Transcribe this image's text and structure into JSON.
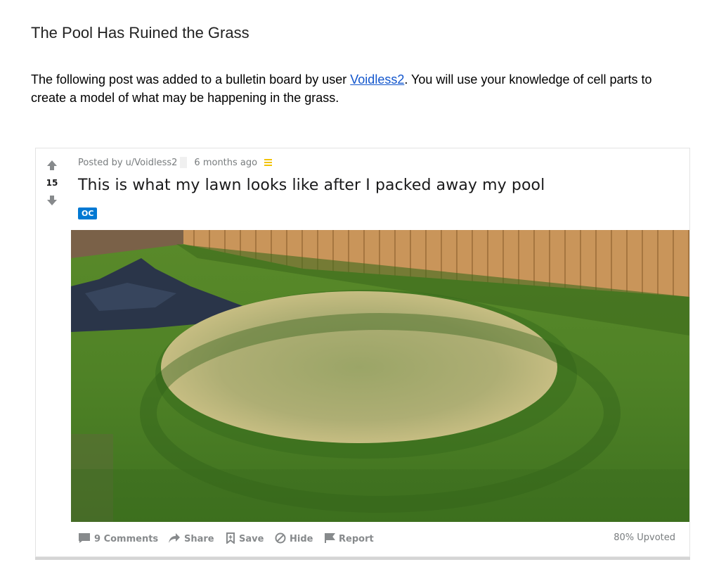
{
  "document": {
    "title": "The Pool Has Ruined the Grass",
    "intro_before_link": "The following post was added to a bulletin board by user ",
    "intro_link": "Voidless2",
    "intro_after_link": ".  You will use your knowledge of cell parts to create a model of what may be happening in the grass."
  },
  "post": {
    "score": "15",
    "posted_by": "Posted by u/Voidless2",
    "time_ago": "6 months ago",
    "title": "This is what my lawn looks like after I packed away my pool",
    "flair": "OC",
    "actions": {
      "comments": "9 Comments",
      "share": "Share",
      "save": "Save",
      "hide": "Hide",
      "report": "Report"
    },
    "upvoted": "80% Upvoted"
  },
  "icons": {
    "upvote": "upvote-arrow-icon",
    "downvote": "downvote-arrow-icon",
    "comments": "comment-bubble-icon",
    "share": "share-arrow-icon",
    "save": "bookmark-icon",
    "hide": "hide-circle-icon",
    "report": "flag-icon",
    "award": "award-icon"
  },
  "colors": {
    "link": "#1155cc",
    "flair_bg": "#0079d3",
    "action_text": "#878a8c"
  }
}
